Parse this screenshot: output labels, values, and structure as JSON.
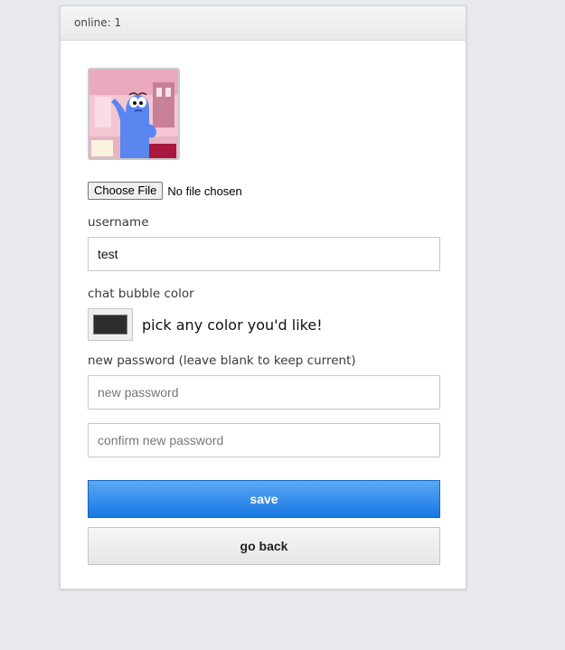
{
  "header": {
    "online_text": "online: 1"
  },
  "profile": {
    "avatar_icon": "avatar-image",
    "file_button_label": "Choose File",
    "file_status": "No file chosen",
    "username_label": "username",
    "username_value": "test",
    "color_label": "chat bubble color",
    "color_value": "#2d2d2d",
    "color_hint": "pick any color you'd like!",
    "password_label": "new password (leave blank to keep current)",
    "new_password_placeholder": "new password",
    "confirm_password_placeholder": "confirm new password",
    "save_label": "save",
    "back_label": "go back"
  },
  "colors": {
    "accent": "#1677e2",
    "background": "#e9eaed"
  }
}
